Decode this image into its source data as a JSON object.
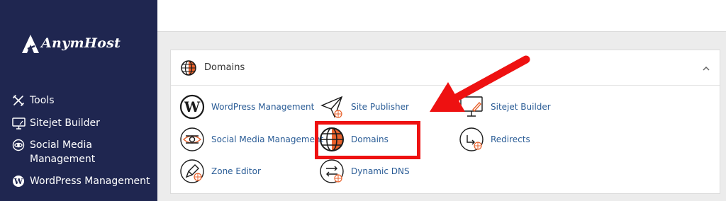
{
  "brand": {
    "name": "AnymHost"
  },
  "sidebar": {
    "items": [
      {
        "label": "Tools",
        "icon": "tools-icon"
      },
      {
        "label": "Sitejet Builder",
        "icon": "monitor-icon"
      },
      {
        "label": "Social Media\nManagement",
        "icon": "social-media-icon"
      },
      {
        "label": "WordPress Management",
        "icon": "wordpress-icon"
      }
    ]
  },
  "panel": {
    "title": "Domains",
    "items": [
      {
        "label": "WordPress Management",
        "icon": "wordpress-icon"
      },
      {
        "label": "Site Publisher",
        "icon": "paper-plane-icon"
      },
      {
        "label": "Sitejet Builder",
        "icon": "sitejet-icon"
      },
      {
        "label": "Social Media Management",
        "icon": "social-media-icon"
      },
      {
        "label": "Domains",
        "icon": "globe-icon"
      },
      {
        "label": "Redirects",
        "icon": "redirect-icon"
      },
      {
        "label": "Zone Editor",
        "icon": "zone-editor-icon"
      },
      {
        "label": "Dynamic DNS",
        "icon": "dynamic-dns-icon"
      }
    ]
  },
  "colors": {
    "sidebar": "#1f2650",
    "accent": "#e8622c",
    "link": "#2a5c96",
    "highlight": "#ee1111"
  }
}
